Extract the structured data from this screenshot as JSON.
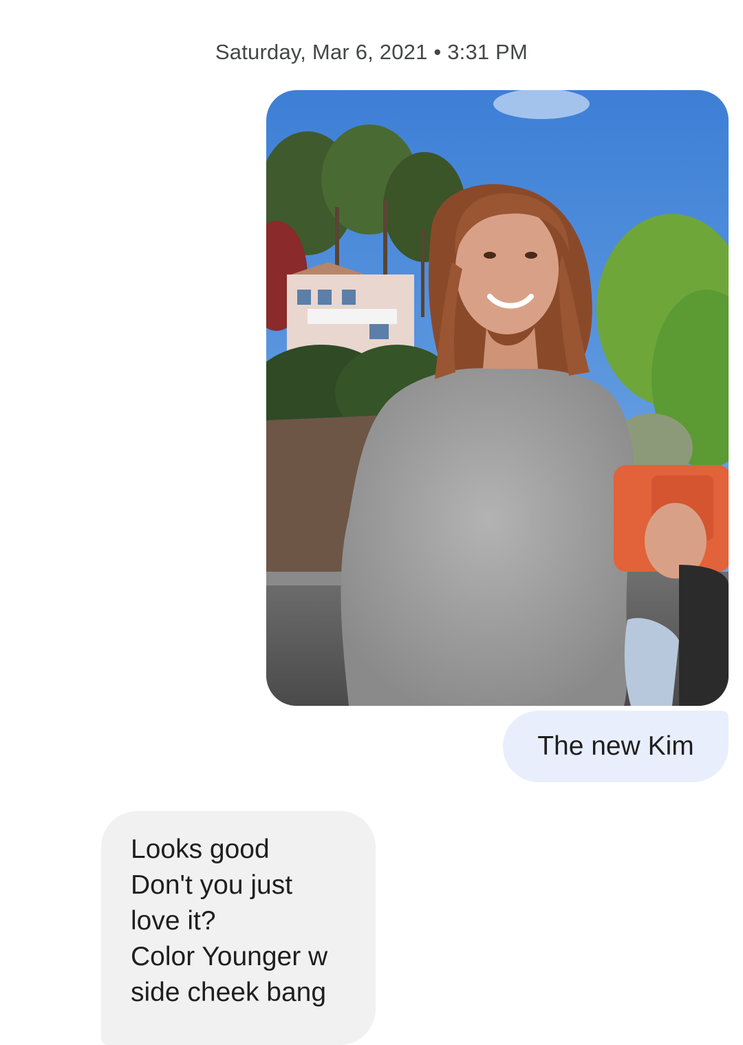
{
  "conversation": {
    "timestamp": "Saturday, Mar 6, 2021 • 3:31 PM",
    "messages": [
      {
        "direction": "outgoing",
        "type": "image",
        "image": {
          "description_icon": "photo-icon"
        }
      },
      {
        "direction": "outgoing",
        "type": "text",
        "text": "The new Kim"
      },
      {
        "direction": "incoming",
        "type": "text",
        "lines": [
          "Looks good",
          "Don't you just",
          "love it?",
          "Color Younger w",
          "side cheek bang"
        ]
      }
    ]
  },
  "colors": {
    "outgoing_bubble": "#e8eefc",
    "incoming_bubble": "#f1f1f1",
    "text": "#1f1f1f",
    "timestamp_text": "#444746"
  }
}
